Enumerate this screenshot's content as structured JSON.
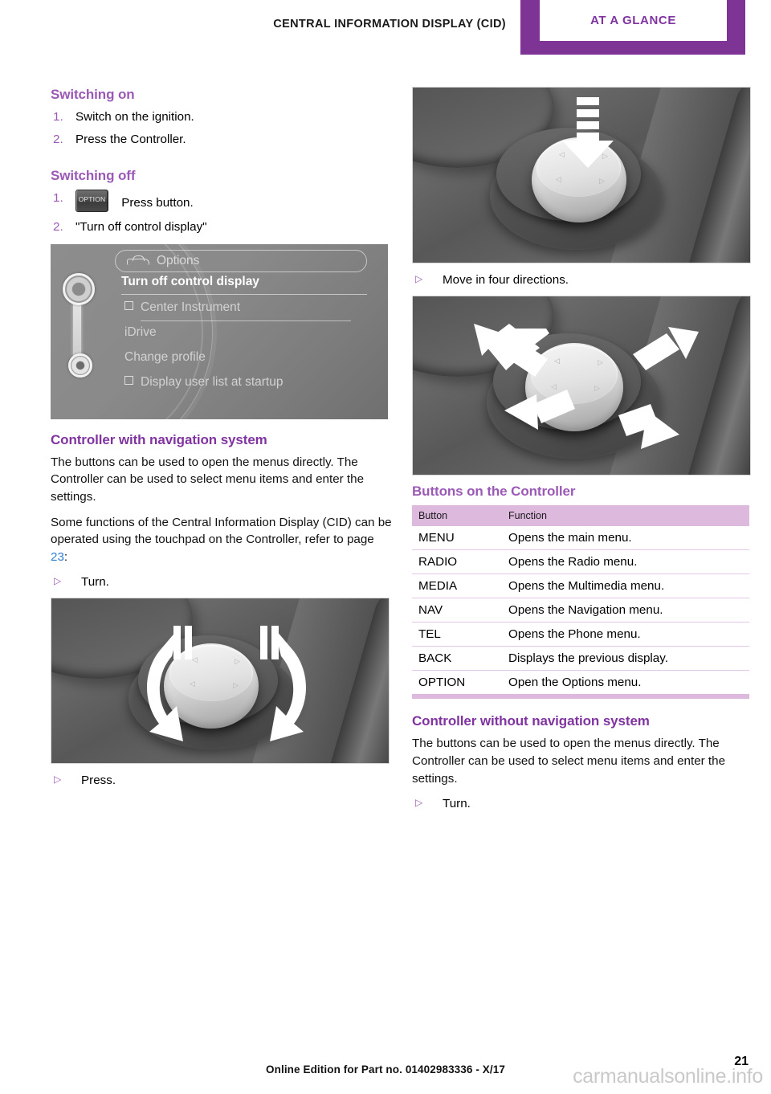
{
  "header": {
    "chapter_title": "CENTRAL INFORMATION DISPLAY (CID)",
    "tab_label": "AT A GLANCE",
    "accent_color": "#7d3494",
    "tab_text_color": "#8034a0"
  },
  "left_column": {
    "switching_on": {
      "heading": "Switching on",
      "steps": [
        {
          "num": "1.",
          "text": "Switch on the ignition."
        },
        {
          "num": "2.",
          "text": "Press the Controller."
        }
      ]
    },
    "switching_off": {
      "heading": "Switching off",
      "step1_num": "1.",
      "step1_key_label": "OPTION",
      "step1_text": "Press button.",
      "step2_num": "2.",
      "step2_text": "\"Turn off control display\""
    },
    "cid_screenshot": {
      "title_bar": "Options",
      "items": [
        {
          "label": "Turn off control display",
          "selected": true,
          "checkbox": false
        },
        {
          "label": "Center Instrument",
          "selected": false,
          "checkbox": true
        },
        {
          "label": "iDrive",
          "selected": false,
          "checkbox": false
        },
        {
          "label": "Change profile",
          "selected": false,
          "checkbox": false
        },
        {
          "label": "Display user list at startup",
          "selected": false,
          "checkbox": true
        }
      ]
    },
    "controller_with_nav": {
      "heading": "Controller with navigation system",
      "para1": "The buttons can be used to open the menus directly. The Controller can be used to select menu items and enter the settings.",
      "para2_before": "Some functions of the Central Information Display (CID) can be operated using the touchpad on the Controller, refer to page ",
      "para2_pageref": "23",
      "para2_after": ":",
      "bullet_turn": "Turn.",
      "bullet_press": "Press."
    }
  },
  "right_column": {
    "bullet_move": "Move in four directions.",
    "buttons_section": {
      "heading": "Buttons on the Controller",
      "columns": [
        "Button",
        "Function"
      ],
      "rows": [
        {
          "button": "MENU",
          "function": "Opens the main menu."
        },
        {
          "button": "RADIO",
          "function": "Opens the Radio menu."
        },
        {
          "button": "MEDIA",
          "function": "Opens the Multimedia menu."
        },
        {
          "button": "NAV",
          "function": "Opens the Navigation menu."
        },
        {
          "button": "TEL",
          "function": "Opens the Phone menu."
        },
        {
          "button": "BACK",
          "function": "Displays the previous display."
        },
        {
          "button": "OPTION",
          "function": "Open the Options menu."
        }
      ],
      "header_bg": "#ddb9dd"
    },
    "controller_without_nav": {
      "heading": "Controller without navigation system",
      "para1": "The buttons can be used to open the menus directly. The Controller can be used to select menu items and enter the settings.",
      "bullet_turn": "Turn."
    }
  },
  "footer": {
    "edition_text": "Online Edition for Part no. 01402983336 - X/17",
    "page_number": "21",
    "watermark": "carmanualsonline.info"
  }
}
